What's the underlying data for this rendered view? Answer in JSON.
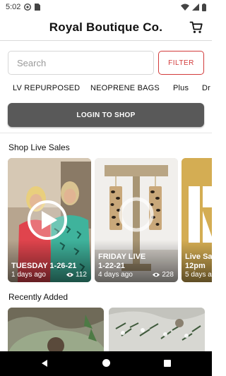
{
  "status_bar": {
    "time": "5:02",
    "icons": [
      "settings-circle-icon",
      "sim-card-icon",
      "wifi-icon",
      "signal-icon",
      "battery-icon"
    ]
  },
  "header": {
    "title": "Royal Boutique Co.",
    "cart_icon": "shopping-cart-icon"
  },
  "search": {
    "placeholder": "Search",
    "filter_label": "FILTER"
  },
  "categories": [
    "LV REPURPOSED",
    "NEOPRENE BAGS",
    "Plus",
    "Dr"
  ],
  "login": {
    "label": "LOGIN TO SHOP"
  },
  "live_sales": {
    "title": "Shop Live Sales",
    "cards": [
      {
        "title": "TUESDAY 1-26-21",
        "time_ago": "1 days ago",
        "views": "112",
        "play_icon": "play-icon"
      },
      {
        "title_line1": "FRIDAY LIVE",
        "title_line2": "1-22-21",
        "time_ago": "4 days ago",
        "views": "228"
      },
      {
        "title_line1": "Live Sa",
        "title_line2": "12pm",
        "time_ago": "5 days a"
      }
    ]
  },
  "recently_added": {
    "title": "Recently Added"
  },
  "nav_bar": {
    "icons": [
      "back-icon",
      "home-icon",
      "recent-apps-icon"
    ]
  },
  "colors": {
    "accent_red": "#d23b3b",
    "login_button": "#595959",
    "nav_bar": "#000000"
  }
}
